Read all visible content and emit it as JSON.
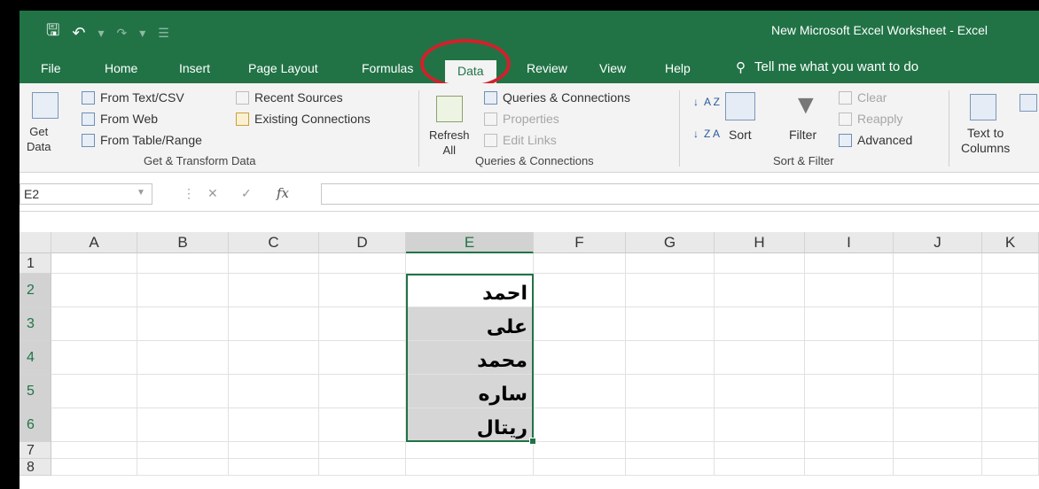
{
  "window": {
    "title": "New Microsoft Excel Worksheet  -  Excel"
  },
  "qat": {
    "save_icon": "save-icon",
    "undo_icon": "undo-icon",
    "redo_icon": "redo-icon"
  },
  "tabs": [
    {
      "label": "File"
    },
    {
      "label": "Home"
    },
    {
      "label": "Insert"
    },
    {
      "label": "Page Layout"
    },
    {
      "label": "Formulas"
    },
    {
      "label": "Data"
    },
    {
      "label": "Review"
    },
    {
      "label": "View"
    },
    {
      "label": "Help"
    }
  ],
  "active_tab": "Data",
  "tell_me": {
    "icon": "lightbulb-icon",
    "text": "Tell me what you want to do"
  },
  "ribbon": {
    "get_transform": {
      "get_data": "Get\nData",
      "from_text_csv": "From Text/CSV",
      "from_web": "From Web",
      "from_table_range": "From Table/Range",
      "recent_sources": "Recent Sources",
      "existing_connections": "Existing Connections",
      "group_label": "Get & Transform Data"
    },
    "queries": {
      "refresh_all": "Refresh\nAll",
      "queries_connections": "Queries & Connections",
      "properties": "Properties",
      "edit_links": "Edit Links",
      "group_label": "Queries & Connections"
    },
    "sort_filter": {
      "sort": "Sort",
      "filter": "Filter",
      "clear": "Clear",
      "reapply": "Reapply",
      "advanced": "Advanced",
      "group_label": "Sort & Filter"
    },
    "data_tools": {
      "text_to_columns": "Text to\nColumns"
    }
  },
  "formula_bar": {
    "name_box": "E2",
    "fx": "fx",
    "value": ""
  },
  "grid": {
    "columns": [
      "A",
      "B",
      "C",
      "D",
      "E",
      "F",
      "G",
      "H",
      "I",
      "J",
      "K"
    ],
    "rows": [
      "1",
      "2",
      "3",
      "4",
      "5",
      "6",
      "7",
      "8"
    ],
    "selected_column": "E",
    "selected_rows": [
      "2",
      "3",
      "4",
      "5",
      "6"
    ],
    "active_cell": "E2",
    "cells": {
      "E2": "احمد",
      "E3": "على",
      "E4": "محمد",
      "E5": "ساره",
      "E6": "ريتال"
    }
  },
  "accent_color": "#217346",
  "annotation_color": "#d3202a"
}
